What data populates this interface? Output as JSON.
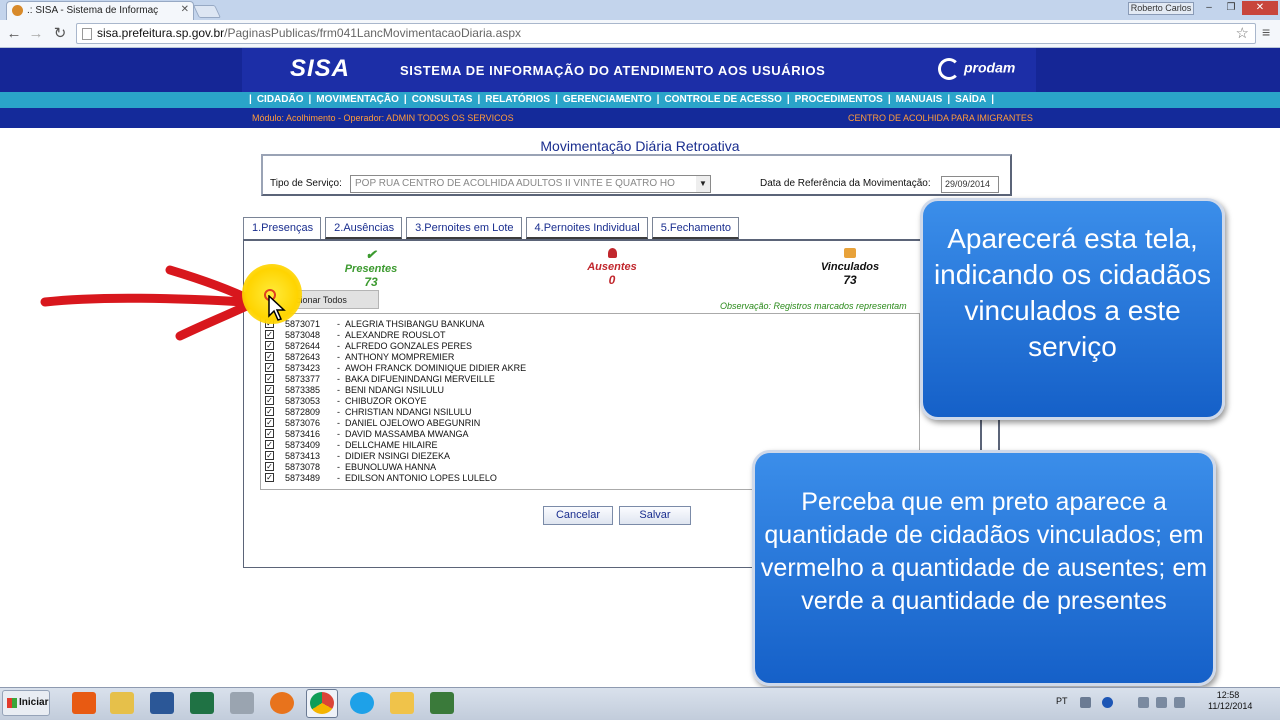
{
  "browser": {
    "tab_title": ".: SISA - Sistema de Informaç",
    "user_badge": "Roberto Carlos",
    "url_host": "sisa.prefeitura.sp.gov.br",
    "url_path": "/PaginasPublicas/frm041LancMovimentacaoDiaria.aspx"
  },
  "header": {
    "logo": "SISA",
    "title": "SISTEMA DE INFORMAÇÃO DO ATENDIMENTO AOS USUÁRIOS",
    "brand": "prodam"
  },
  "menu": {
    "items": [
      "CIDADÃO",
      "MOVIMENTAÇÃO",
      "CONSULTAS",
      "RELATÓRIOS",
      "GERENCIAMENTO",
      "CONTROLE DE ACESSO",
      "PROCEDIMENTOS",
      "MANUAIS",
      "SAÍDA"
    ]
  },
  "subbar": {
    "module": "Módulo: Acolhimento - Operador: ADMIN TODOS OS SERVICOS",
    "center": "CENTRO DE ACOLHIDA PARA IMIGRANTES"
  },
  "page": {
    "title": "Movimentação Diária Retroativa",
    "service_label": "Tipo de Serviço:",
    "service_value": "POP RUA CENTRO DE ACOLHIDA ADULTOS II VINTE E QUATRO HO",
    "date_label": "Data de Referência da Movimentação:",
    "date_value": "29/09/2014"
  },
  "tabs": [
    "1.Presenças",
    "2.Ausências",
    "3.Pernoites em Lote",
    "4.Pernoites Individual",
    "5.Fechamento"
  ],
  "stats": {
    "presentes_label": "Presentes",
    "presentes_value": "73",
    "ausentes_label": "Ausentes",
    "ausentes_value": "0",
    "vinculados_label": "Vinculados",
    "vinculados_value": "73"
  },
  "select_all_label": "Selecionar Todos",
  "observation": "Observação: Registros marcados representam",
  "records": [
    {
      "id": "5873071",
      "name": "ALEGRIA THSIBANGU BANKUNA"
    },
    {
      "id": "5873048",
      "name": "ALEXANDRE ROUSLOT"
    },
    {
      "id": "5872644",
      "name": "ALFREDO GONZALES PERES"
    },
    {
      "id": "5872643",
      "name": "ANTHONY MOMPREMIER"
    },
    {
      "id": "5873423",
      "name": "AWOH FRANCK DOMINIQUE DIDIER AKRE"
    },
    {
      "id": "5873377",
      "name": "BAKA DIFUENINDANGI MERVEILLE"
    },
    {
      "id": "5873385",
      "name": "BENI NDANGI NSILULU"
    },
    {
      "id": "5873053",
      "name": "CHIBUZOR OKOYE"
    },
    {
      "id": "5872809",
      "name": "CHRISTIAN NDANGI NSILULU"
    },
    {
      "id": "5873076",
      "name": "DANIEL OJELOWO ABEGUNRIN"
    },
    {
      "id": "5873416",
      "name": "DAVID MASSAMBA MWANGA"
    },
    {
      "id": "5873409",
      "name": "DELLCHAME HILAIRE"
    },
    {
      "id": "5873413",
      "name": "DIDIER NSINGI DIEZEKA"
    },
    {
      "id": "5873078",
      "name": "EBUNOLUWA HANNA"
    },
    {
      "id": "5873489",
      "name": "EDILSON ANTONIO LOPES LULELO"
    }
  ],
  "buttons": {
    "cancel": "Cancelar",
    "save": "Salvar"
  },
  "callouts": {
    "first": "Aparecerá esta tela, indicando os cidadãos vinculados a este serviço",
    "second": "Perceba que em preto aparece a quantidade de cidadãos vinculados; em vermelho a quantidade de ausentes; em verde a quantidade de presentes"
  },
  "taskbar": {
    "start": "Iniciar",
    "lang": "PT",
    "time": "12:58",
    "date": "11/12/2014"
  },
  "colors": {
    "header_blue": "#1c2ea7",
    "menu_cyan": "#2aa4c9",
    "present_green": "#3c9a2f",
    "absent_red": "#c1272d",
    "callout_blue": "#1560c8"
  }
}
